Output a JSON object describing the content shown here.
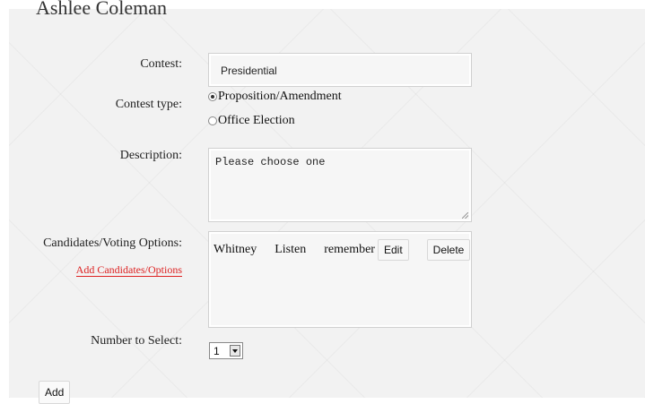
{
  "header": {
    "title": "Ashlee Coleman"
  },
  "form": {
    "contest_label": "Contest:",
    "contest_value": "Presidential",
    "contest_type_label": "Contest type:",
    "contest_type_options": [
      "Proposition/Amendment",
      "Office Election"
    ],
    "contest_type_selected": "Proposition/Amendment",
    "description_label": "Description:",
    "description_value": "Please choose one",
    "candidates_label": "Candidates/Voting Options:",
    "add_candidates_link": "Add Candidates/Options",
    "candidates": [
      {
        "name": "Whitney",
        "party": "Listen",
        "note": "remember"
      }
    ],
    "edit_button": "Edit",
    "delete_button": "Delete",
    "number_label": "Number to Select:",
    "number_value": "1",
    "add_button": "Add"
  }
}
